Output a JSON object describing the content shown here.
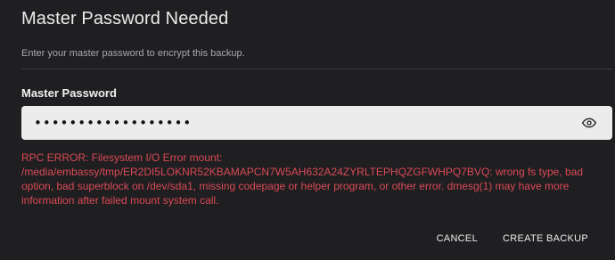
{
  "dialog": {
    "title": "Master Password Needed",
    "subtitle": "Enter your master password to encrypt this backup.",
    "field_label": "Master Password",
    "password_value": "••••••••••••••••••",
    "visibility_icon": "eye-icon",
    "error_text": "RPC ERROR: Filesystem I/O Error mount: /media/embassy/tmp/ER2DI5LOKNR52KBAMAPCN7W5AH632A24ZYRLTEPHQZGFWHPQ7BVQ: wrong fs type, bad option, bad superblock on /dev/sda1, missing codepage or helper program, or other error. dmesg(1) may have more information after failed mount system call.",
    "cancel_label": "CANCEL",
    "create_label": "CREATE BACKUP"
  },
  "colors": {
    "background": "#1f1e21",
    "error": "#d94b55",
    "input_bg": "#ececec"
  }
}
